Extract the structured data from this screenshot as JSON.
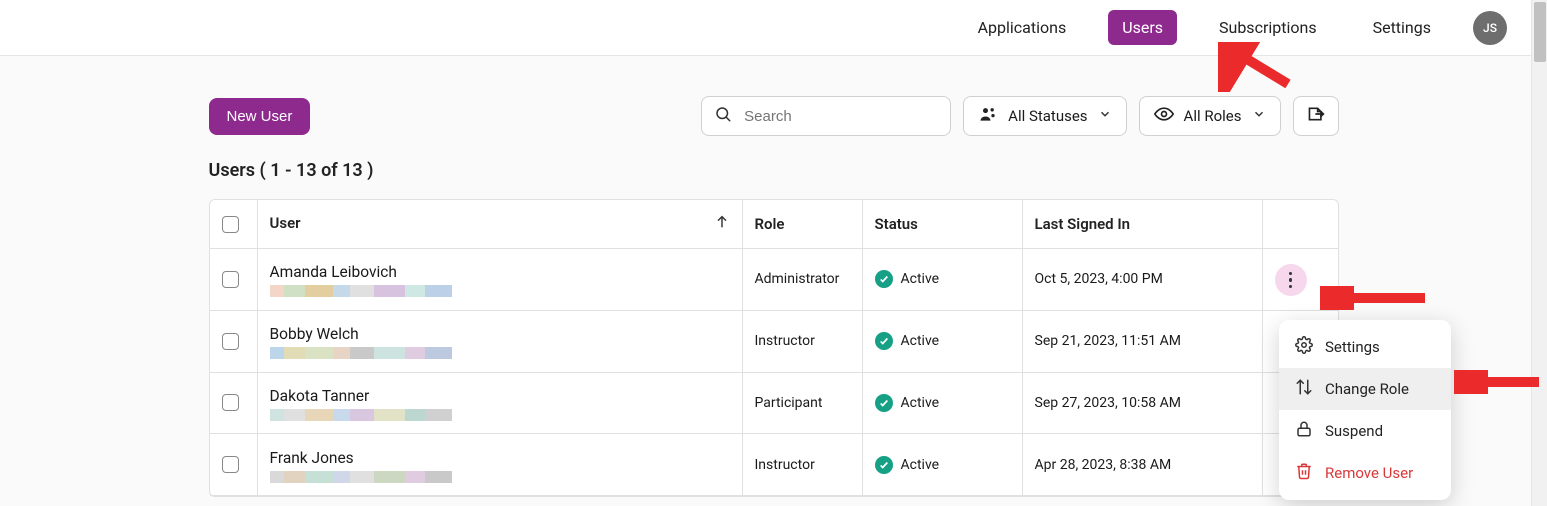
{
  "nav": {
    "items": [
      {
        "label": "Applications",
        "active": false
      },
      {
        "label": "Users",
        "active": true
      },
      {
        "label": "Subscriptions",
        "active": false
      },
      {
        "label": "Settings",
        "active": false
      }
    ],
    "avatar_initials": "JS"
  },
  "toolbar": {
    "new_user_label": "New User",
    "search_placeholder": "Search",
    "status_filter_label": "All Statuses",
    "role_filter_label": "All Roles"
  },
  "count_line": "Users ( 1 - 13 of 13 )",
  "columns": {
    "user": "User",
    "role": "Role",
    "status": "Status",
    "last_signed_in": "Last Signed In"
  },
  "rows": [
    {
      "name": "Amanda Leibovich",
      "role": "Administrator",
      "status": "Active",
      "last_signed_in": "Oct 5, 2023, 4:00 PM",
      "menu_open": true
    },
    {
      "name": "Bobby Welch",
      "role": "Instructor",
      "status": "Active",
      "last_signed_in": "Sep 21, 2023, 11:51 AM",
      "menu_open": false
    },
    {
      "name": "Dakota Tanner",
      "role": "Participant",
      "status": "Active",
      "last_signed_in": "Sep 27, 2023, 10:58 AM",
      "menu_open": false
    },
    {
      "name": "Frank Jones",
      "role": "Instructor",
      "status": "Active",
      "last_signed_in": "Apr 28, 2023, 8:38 AM",
      "menu_open": false
    }
  ],
  "menu": {
    "settings": "Settings",
    "change_role": "Change Role",
    "suspend": "Suspend",
    "remove_user": "Remove User"
  }
}
